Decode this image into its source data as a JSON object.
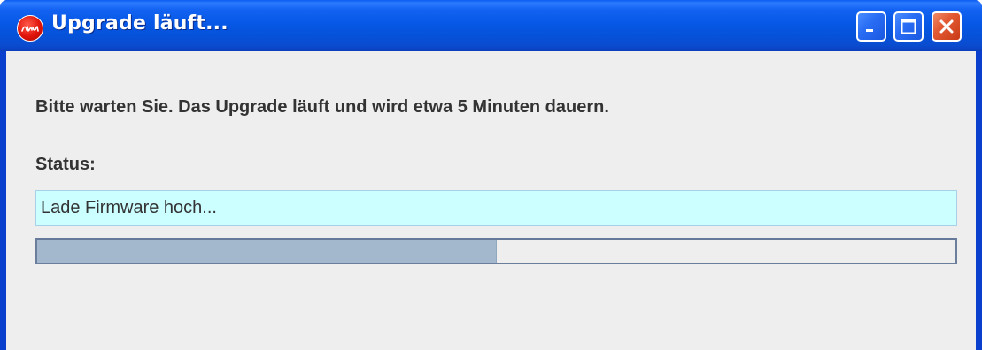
{
  "window": {
    "title": "Upgrade läuft...",
    "app_icon": "avm-fritz-logo-icon",
    "controls": {
      "minimize_icon": "minimize-icon",
      "maximize_icon": "maximize-icon",
      "close_icon": "close-icon"
    }
  },
  "dialog": {
    "message": "Bitte warten Sie. Das Upgrade läuft und wird etwa 5 Minuten dauern.",
    "status_label": "Status:",
    "status_value": "Lade Firmware hoch...",
    "progress_fraction": 0.5
  },
  "colors": {
    "titlebar": "#0553d9",
    "window_bg": "#eeeeee",
    "status_field_bg": "#ccffff",
    "progress_fill": "#a3b8cc",
    "progress_border": "#6b7f9c",
    "close_button": "#e25a33"
  }
}
